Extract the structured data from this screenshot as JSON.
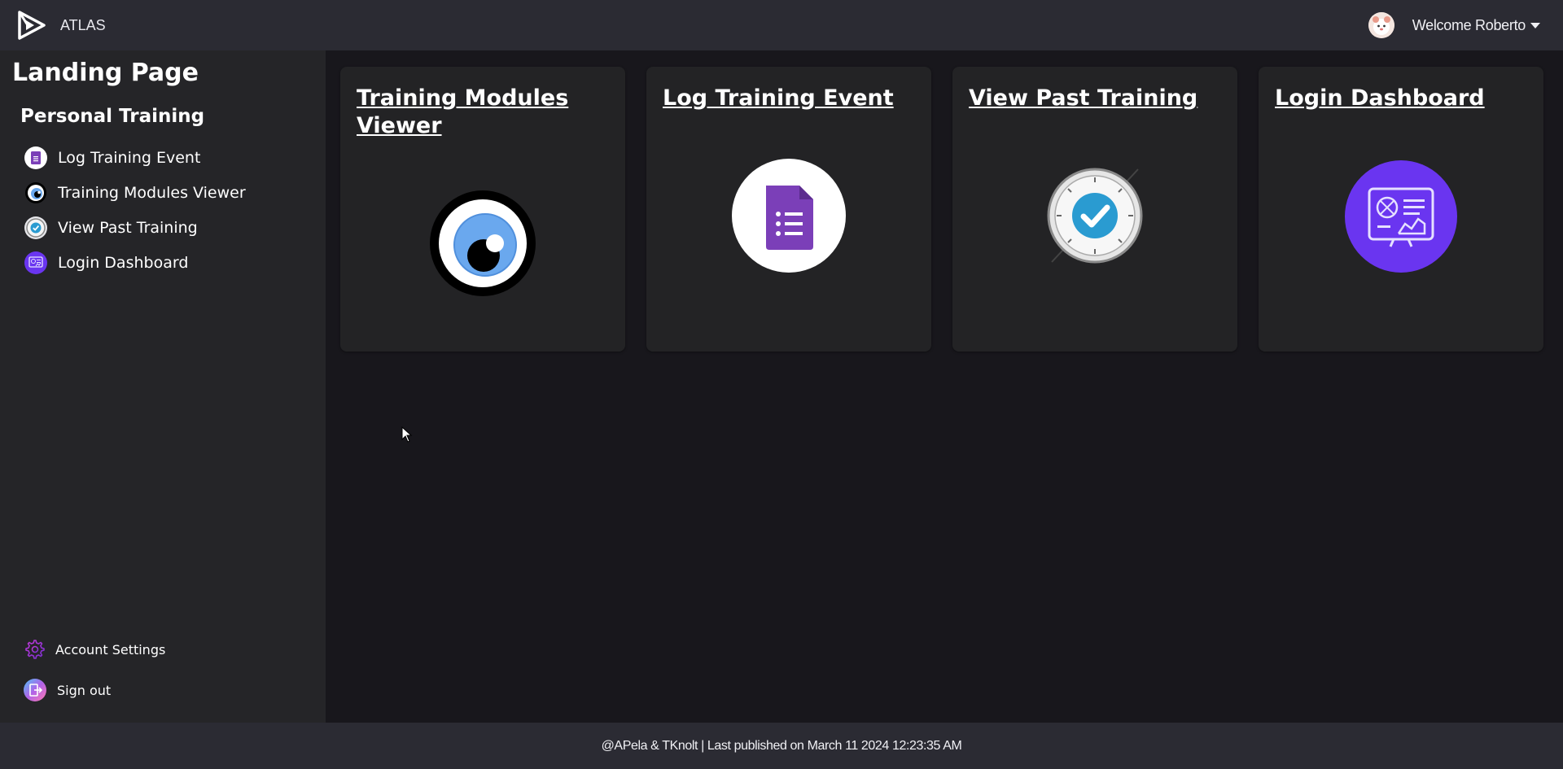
{
  "header": {
    "app_name": "ATLAS",
    "welcome_text": "Welcome Roberto"
  },
  "sidebar": {
    "title": "Landing Page",
    "section": "Personal Training",
    "items": [
      {
        "label": "Log Training Event",
        "icon": "form-icon"
      },
      {
        "label": "Training Modules Viewer",
        "icon": "eye-icon"
      },
      {
        "label": "View Past Training",
        "icon": "clock-check-icon"
      },
      {
        "label": "Login Dashboard",
        "icon": "dashboard-icon"
      }
    ],
    "bottom_items": [
      {
        "label": "Account Settings",
        "icon": "gear-icon"
      },
      {
        "label": "Sign out",
        "icon": "sign-out-icon"
      }
    ]
  },
  "cards": [
    {
      "title": "Training Modules Viewer",
      "icon": "eye-icon"
    },
    {
      "title": "Log Training Event",
      "icon": "form-icon"
    },
    {
      "title": "View Past Training",
      "icon": "clock-check-icon"
    },
    {
      "title": "Login Dashboard",
      "icon": "dashboard-icon"
    }
  ],
  "footer": {
    "text": "@APela & TKnolt | Last published on March 11 2024 12:23:35 AM"
  },
  "colors": {
    "topbar": "#2b2b33",
    "sidebar": "#252528",
    "content": "#18171c",
    "card": "#232325",
    "form_purple": "#7b3fb8",
    "dashboard_purple": "#6a35f0",
    "check_blue": "#2a9bd1",
    "eye_blue": "#6aa8ee"
  }
}
